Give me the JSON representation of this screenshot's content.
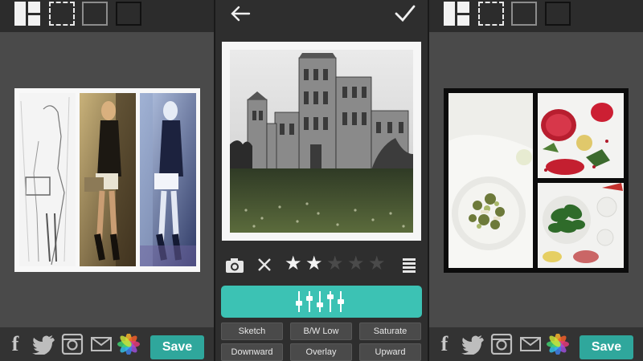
{
  "panels": {
    "left": {
      "share": {
        "facebook": "f",
        "icons": [
          "facebook-icon",
          "twitter-icon",
          "instagram-icon",
          "mail-icon",
          "photos-icon"
        ]
      },
      "save_label": "Save"
    },
    "middle": {
      "tools": [
        "camera-icon",
        "close-icon",
        "star-icon",
        "adjust-icon"
      ],
      "rating": {
        "value": 2,
        "max": 5
      },
      "filters": [
        "Sketch",
        "B/W Low",
        "Saturate",
        "Downward",
        "Overlay",
        "Upward"
      ]
    },
    "right": {
      "share": {
        "facebook": "f",
        "icons": [
          "facebook-icon",
          "twitter-icon",
          "instagram-icon",
          "mail-icon",
          "photos-icon"
        ]
      },
      "save_label": "Save"
    }
  },
  "colors": {
    "accent": "#2fa79c",
    "slider": "#3cc2b4",
    "bar": "#2c2c2c",
    "canvas": "#4a4a4a"
  }
}
